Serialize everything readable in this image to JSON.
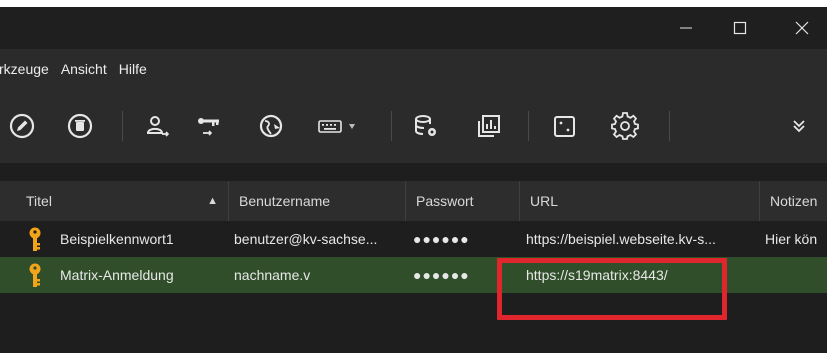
{
  "window": {
    "controls": {
      "minimize": "—",
      "maximize": "☐",
      "close": "✕"
    }
  },
  "menu": {
    "items": [
      "rkzeuge",
      "Ansicht",
      "Hilfe"
    ]
  },
  "toolbar": {
    "icons": [
      "edit-entry-icon",
      "delete-entry-icon",
      "user-transfer-icon",
      "key-transfer-icon",
      "globe-icon",
      "keyboard-icon",
      "database-settings-icon",
      "report-icon",
      "dice-icon",
      "settings-icon",
      "more-icon"
    ]
  },
  "table": {
    "columns": [
      "Titel",
      "Benutzername",
      "Passwort",
      "URL",
      "Notizen"
    ],
    "sort_indicator": "▲",
    "rows": [
      {
        "title": "Beispielkennwort1",
        "username": "benutzer@kv-sachse...",
        "password": "●●●●●●",
        "url": "https://beispiel.webseite.kv-s...",
        "notes": "Hier kön",
        "selected": false
      },
      {
        "title": "Matrix-Anmeldung",
        "username": "nachname.v",
        "password": "●●●●●●",
        "url": "https://s19matrix:8443/",
        "notes": "",
        "selected": true
      }
    ]
  },
  "colors": {
    "selected_row": "#2f4e29",
    "highlight": "#e0262d",
    "key_icon": "#f2a51a"
  }
}
